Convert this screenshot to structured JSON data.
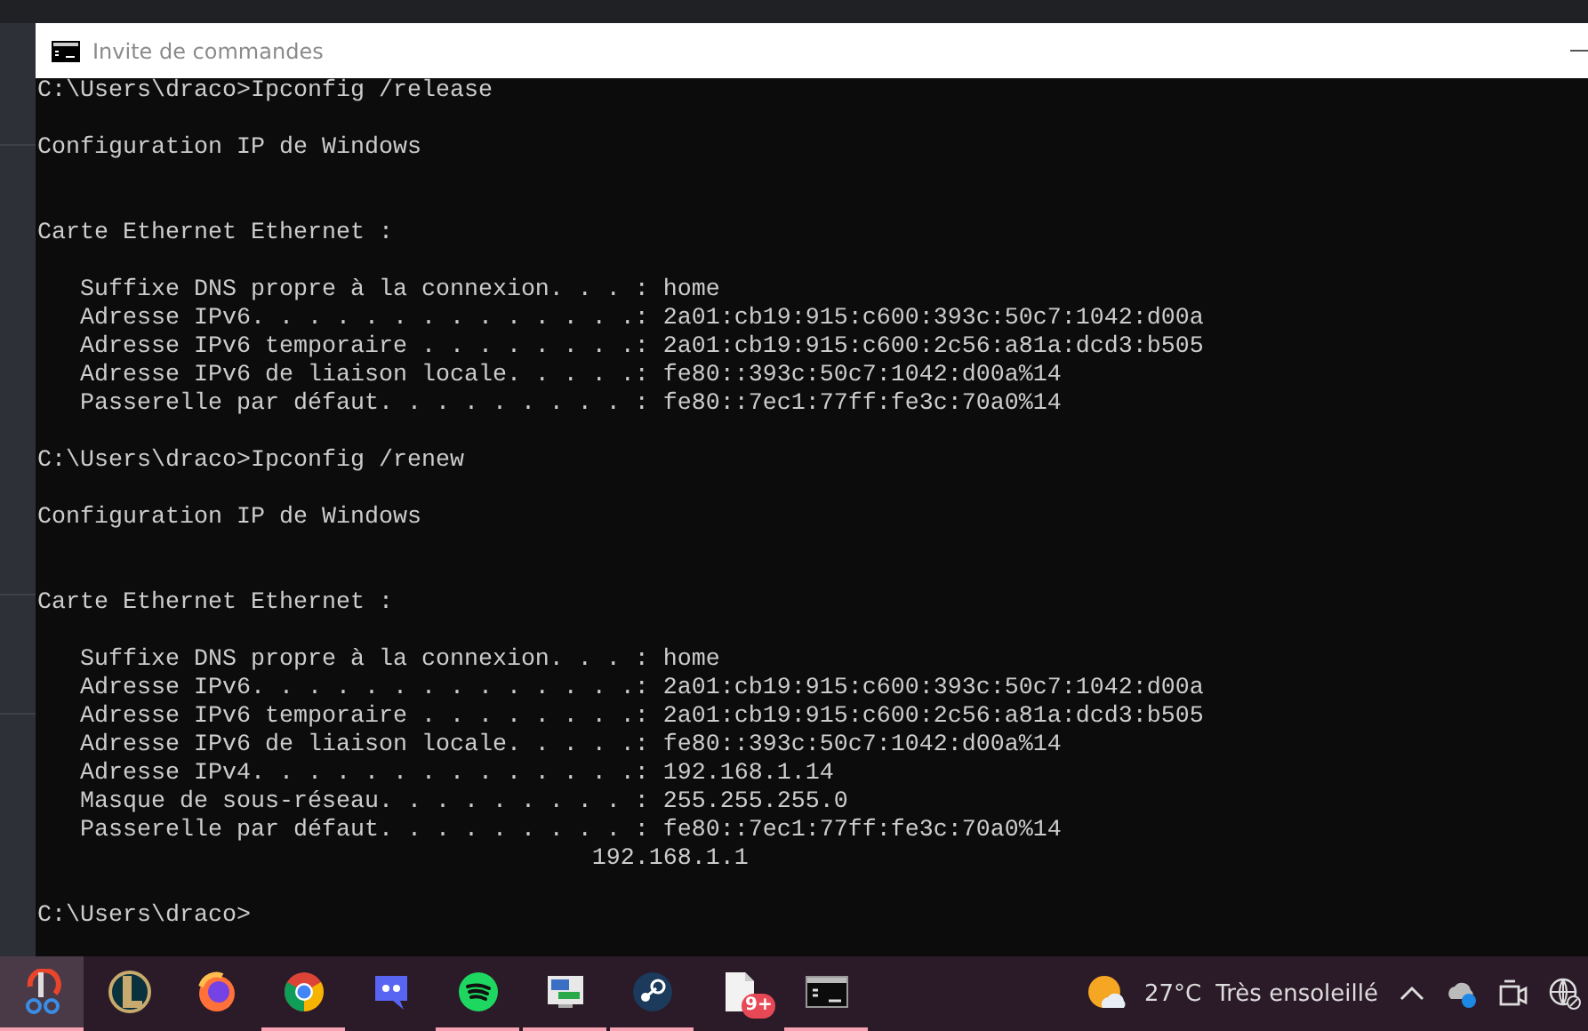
{
  "window": {
    "title": "Invite de commandes"
  },
  "console": {
    "lines": [
      {
        "kind": "text",
        "text": "C:\\Users\\draco>Ipconfig /release"
      },
      {
        "kind": "blank"
      },
      {
        "kind": "text",
        "text": "Configuration IP de Windows"
      },
      {
        "kind": "blank"
      },
      {
        "kind": "blank"
      },
      {
        "kind": "text",
        "text": "Carte Ethernet Ethernet :"
      },
      {
        "kind": "blank"
      },
      {
        "kind": "text",
        "text": "   Suffixe DNS propre à la connexion. . . : home"
      },
      {
        "kind": "text",
        "text": "   Adresse IPv6. . . . . . . . . . . . . .: 2a01:cb19:915:c600:393c:50c7:1042:d00a"
      },
      {
        "kind": "text",
        "text": "   Adresse IPv6 temporaire . . . . . . . .: 2a01:cb19:915:c600:2c56:a81a:dcd3:b505"
      },
      {
        "kind": "text",
        "text": "   Adresse IPv6 de liaison locale. . . . .: fe80::393c:50c7:1042:d00a%14"
      },
      {
        "kind": "text",
        "text": "   Passerelle par défaut. . . . . . . . . : fe80::7ec1:77ff:fe3c:70a0%14"
      },
      {
        "kind": "blank"
      },
      {
        "kind": "text",
        "text": "C:\\Users\\draco>Ipconfig /renew"
      },
      {
        "kind": "blank"
      },
      {
        "kind": "text",
        "text": "Configuration IP de Windows"
      },
      {
        "kind": "blank"
      },
      {
        "kind": "blank"
      },
      {
        "kind": "text",
        "text": "Carte Ethernet Ethernet :"
      },
      {
        "kind": "blank"
      },
      {
        "kind": "text",
        "text": "   Suffixe DNS propre à la connexion. . . : home"
      },
      {
        "kind": "text",
        "text": "   Adresse IPv6. . . . . . . . . . . . . .: 2a01:cb19:915:c600:393c:50c7:1042:d00a"
      },
      {
        "kind": "text",
        "text": "   Adresse IPv6 temporaire . . . . . . . .: 2a01:cb19:915:c600:2c56:a81a:dcd3:b505"
      },
      {
        "kind": "text",
        "text": "   Adresse IPv6 de liaison locale. . . . .: fe80::393c:50c7:1042:d00a%14"
      },
      {
        "kind": "text",
        "text": "   Adresse IPv4. . . . . . . . . . . . . .: 192.168.1.14"
      },
      {
        "kind": "text",
        "text": "   Masque de sous-réseau. . . . . . . . . : 255.255.255.0"
      },
      {
        "kind": "text",
        "text": "   Passerelle par défaut. . . . . . . . . : fe80::7ec1:77ff:fe3c:70a0%14"
      },
      {
        "kind": "text",
        "text": "                                       192.168.1.1"
      },
      {
        "kind": "blank"
      },
      {
        "kind": "text",
        "text": "C:\\Users\\draco>"
      }
    ]
  },
  "taskbar": {
    "apps": [
      {
        "kind": "scissors",
        "selected": true,
        "running": true
      },
      {
        "kind": "letter-l",
        "selected": false,
        "running": false
      },
      {
        "kind": "fox",
        "selected": false,
        "running": false
      },
      {
        "kind": "chrome",
        "selected": false,
        "running": true
      },
      {
        "kind": "chat",
        "selected": false,
        "running": false
      },
      {
        "kind": "waves",
        "selected": false,
        "running": true
      },
      {
        "kind": "monitor",
        "selected": false,
        "running": true
      },
      {
        "kind": "steam",
        "selected": false,
        "running": true
      },
      {
        "kind": "document",
        "selected": false,
        "running": false,
        "badge": "9+"
      },
      {
        "kind": "terminal",
        "selected": false,
        "running": true
      }
    ],
    "weather": {
      "temperature": "27°C",
      "condition": "Très ensoleillé"
    },
    "tray": [
      {
        "kind": "chevron"
      },
      {
        "kind": "cloud"
      },
      {
        "kind": "camera"
      },
      {
        "kind": "globe"
      }
    ]
  }
}
